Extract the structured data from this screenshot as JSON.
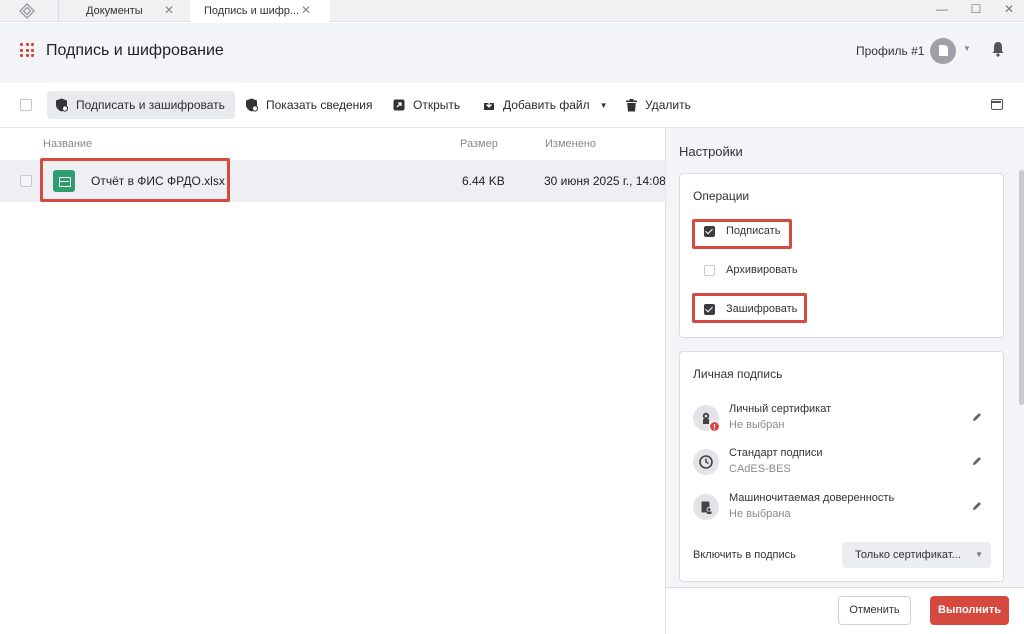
{
  "titlebar": {
    "tabs": [
      {
        "label": "Документы"
      },
      {
        "label": "Подпись и шифр..."
      }
    ]
  },
  "header": {
    "title": "Подпись и шифрование",
    "profile": "Профиль #1"
  },
  "toolbar": {
    "sign_encrypt": "Подписать и зашифровать",
    "show_info": "Показать сведения",
    "open": "Открыть",
    "add_file": "Добавить файл",
    "delete": "Удалить"
  },
  "filelist": {
    "columns": {
      "name": "Название",
      "size": "Размер",
      "modified": "Изменено"
    },
    "rows": [
      {
        "name": "Отчёт в ФИС ФРДО.xlsx",
        "size": "6.44 KB",
        "modified": "30 июня 2025 г., 14:08"
      }
    ]
  },
  "settings": {
    "title": "Настройки",
    "operations": {
      "title": "Операции",
      "sign": {
        "label": "Подписать",
        "checked": true
      },
      "archive": {
        "label": "Архивировать",
        "checked": false
      },
      "encrypt": {
        "label": "Зашифровать",
        "checked": true
      }
    },
    "signature": {
      "title": "Личная подпись",
      "certificate": {
        "label": "Личный сертификат",
        "value": "Не выбран"
      },
      "standard": {
        "label": "Стандарт подписи",
        "value": "CAdES-BES"
      },
      "proxy": {
        "label": "Машиночитаемая доверенность",
        "value": "Не выбрана"
      },
      "include_label": "Включить в подпись",
      "include_value": "Только сертификат..."
    },
    "cancel": "Отменить",
    "run": "Выполнить"
  },
  "colors": {
    "accent": "#d5493f",
    "file_icon": "#2f9e6e",
    "panel_bg": "#f3f4f8"
  }
}
